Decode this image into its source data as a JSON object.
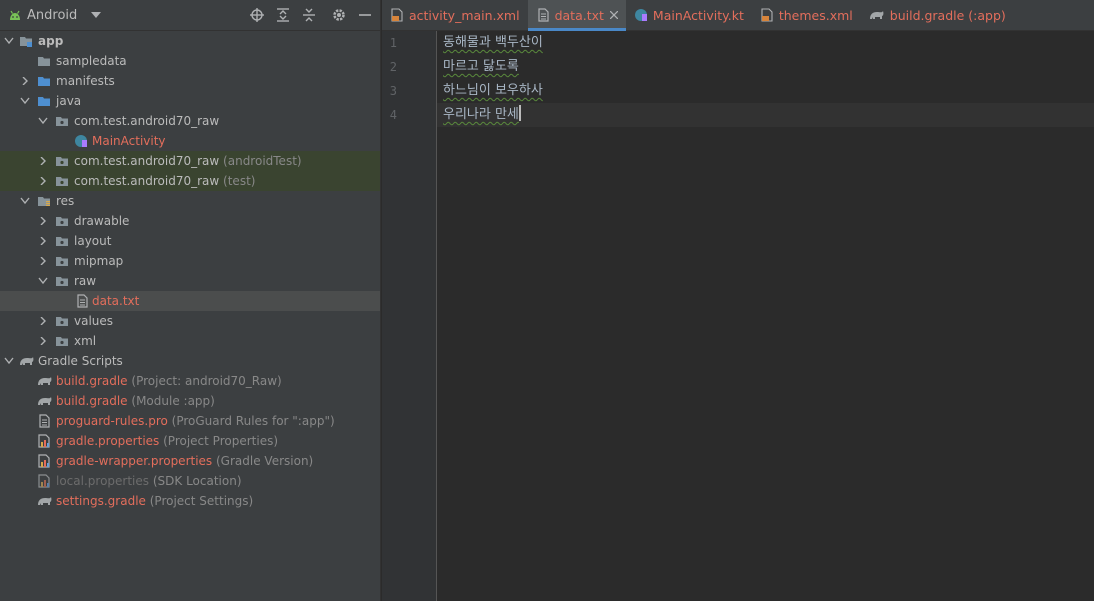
{
  "project_panel": {
    "view_label": "Android",
    "tree": [
      {
        "label": "app",
        "secondary": ""
      },
      {
        "label": "sampledata",
        "secondary": ""
      },
      {
        "label": "manifests",
        "secondary": ""
      },
      {
        "label": "java",
        "secondary": ""
      },
      {
        "label": "com.test.android70_raw",
        "secondary": ""
      },
      {
        "label": "MainActivity",
        "secondary": ""
      },
      {
        "label": "com.test.android70_raw",
        "secondary": "(androidTest)"
      },
      {
        "label": "com.test.android70_raw",
        "secondary": "(test)"
      },
      {
        "label": "res",
        "secondary": ""
      },
      {
        "label": "drawable",
        "secondary": ""
      },
      {
        "label": "layout",
        "secondary": ""
      },
      {
        "label": "mipmap",
        "secondary": ""
      },
      {
        "label": "raw",
        "secondary": ""
      },
      {
        "label": "data.txt",
        "secondary": ""
      },
      {
        "label": "values",
        "secondary": ""
      },
      {
        "label": "xml",
        "secondary": ""
      },
      {
        "label": "Gradle Scripts",
        "secondary": ""
      },
      {
        "label": "build.gradle",
        "secondary": "(Project: android70_Raw)"
      },
      {
        "label": "build.gradle",
        "secondary": "(Module :app)"
      },
      {
        "label": "proguard-rules.pro",
        "secondary": "(ProGuard Rules for \":app\")"
      },
      {
        "label": "gradle.properties",
        "secondary": "(Project Properties)"
      },
      {
        "label": "gradle-wrapper.properties",
        "secondary": "(Gradle Version)"
      },
      {
        "label": "local.properties",
        "secondary": "(SDK Location)"
      },
      {
        "label": "settings.gradle",
        "secondary": "(Project Settings)"
      }
    ]
  },
  "tabs": [
    {
      "label": "activity_main.xml"
    },
    {
      "label": "data.txt"
    },
    {
      "label": "MainActivity.kt"
    },
    {
      "label": "themes.xml"
    },
    {
      "label": "build.gradle (:app)"
    }
  ],
  "editor": {
    "lines": [
      {
        "number": "1",
        "text": "동해물과 백두산이"
      },
      {
        "number": "2",
        "text": "마르고 닳도록"
      },
      {
        "number": "3",
        "text": "하느님이 보우하사"
      },
      {
        "number": "4",
        "text": "우리나라 만세"
      }
    ]
  },
  "colors": {
    "accent": "#4a88c7",
    "file_modified": "#e36e5c",
    "panel_bg": "#3c3f41",
    "editor_bg": "#2b2b2b",
    "test_highlight": "#3a4430"
  }
}
